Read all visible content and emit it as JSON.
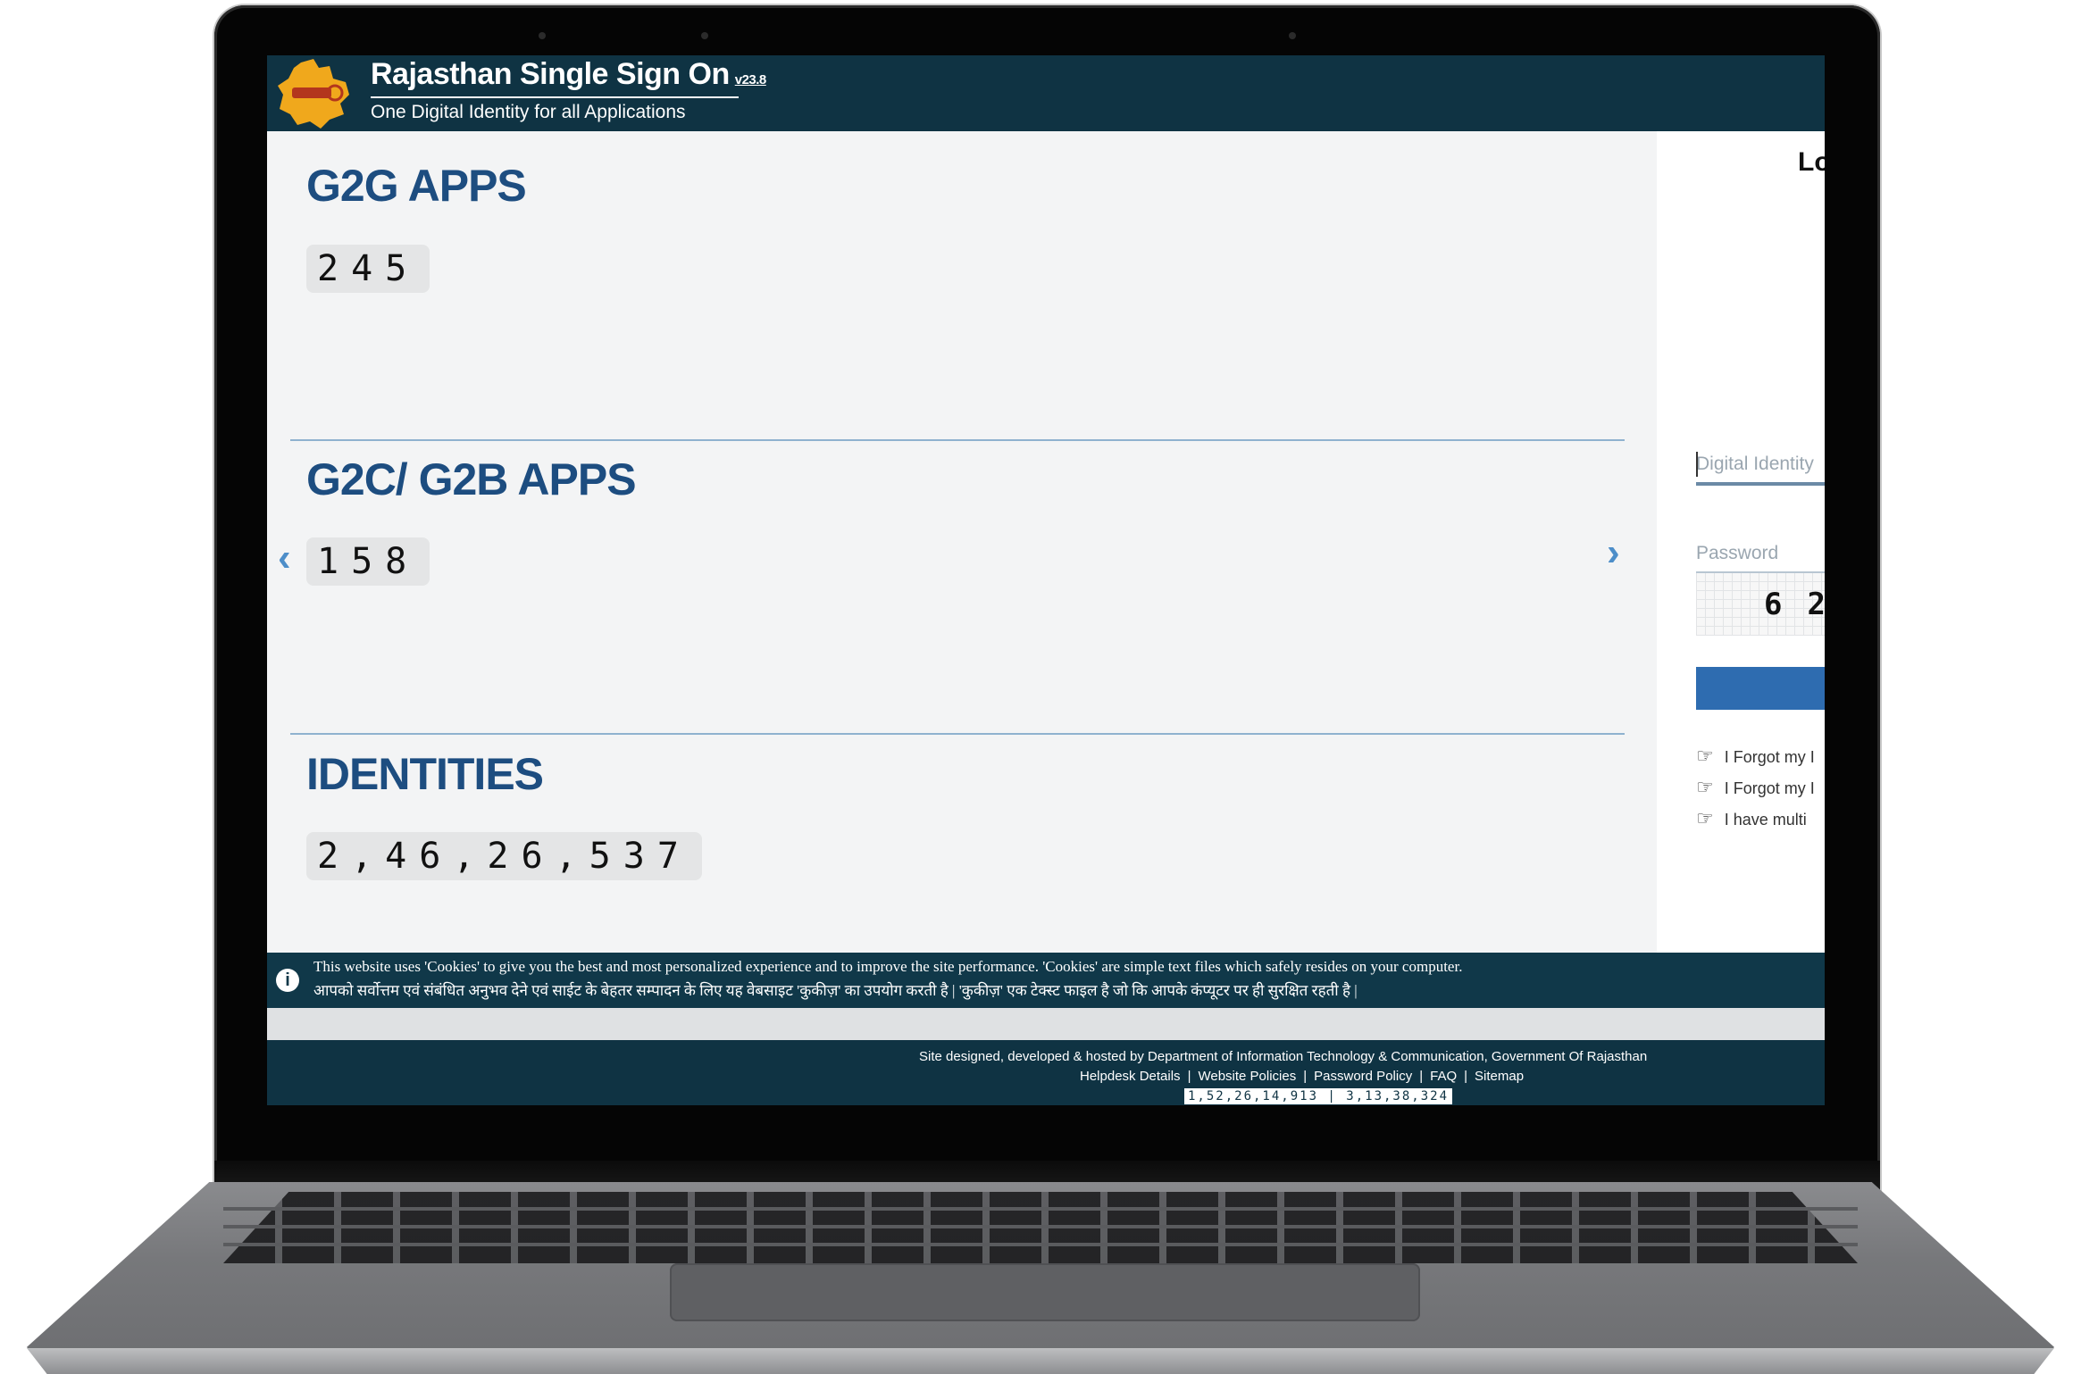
{
  "header": {
    "title": "Rajasthan Single Sign On",
    "version": "v23.8",
    "subtitle": "One Digital Identity for all Applications"
  },
  "sections": {
    "g2g": {
      "title": "G2G APPS",
      "count": "245"
    },
    "g2c": {
      "title": "G2C/ G2B APPS",
      "count": "158"
    },
    "identities": {
      "title": "IDENTITIES",
      "count": "2,46,26,537"
    }
  },
  "login": {
    "heading": "Lo",
    "digital_identity_placeholder": "Digital Identity",
    "password_placeholder": "Password",
    "captcha_text": "62",
    "links": [
      "I Forgot my I",
      "I Forgot my I",
      "I have multi"
    ]
  },
  "cookie_notice": {
    "english": "This website uses 'Cookies' to give you the best and most personalized experience and to improve the site performance. 'Cookies' are simple text files which safely resides on your computer.",
    "hindi": "आपको सर्वोत्तम एवं संबंधित अनुभव देने एवं साईट के बेहतर सम्पादन के लिए यह वेबसाइट 'कुकीज़' का उपयोग करती है | 'कुकीज़' एक टेक्स्ट फाइल है जो कि आपके कंप्यूटर पर ही सुरक्षित रहती है |"
  },
  "footer": {
    "credit": "Site designed, developed & hosted by Department of Information Technology & Communication, Government Of Rajasthan",
    "links": [
      "Helpdesk Details",
      "Website Policies",
      "Password Policy",
      "FAQ",
      "Sitemap"
    ],
    "visitor_counter": "1,52,26,14,913 | 3,13,38,324"
  },
  "icons": {
    "prev": "chevron-left-icon",
    "next": "chevron-right-icon",
    "info": "info-icon",
    "link": "pointing-hand-icon"
  },
  "colors": {
    "header_bg": "#0f3343",
    "section_title": "#1d4d80",
    "arrow": "#4d8ec9",
    "login_button": "#2e6cb0"
  }
}
